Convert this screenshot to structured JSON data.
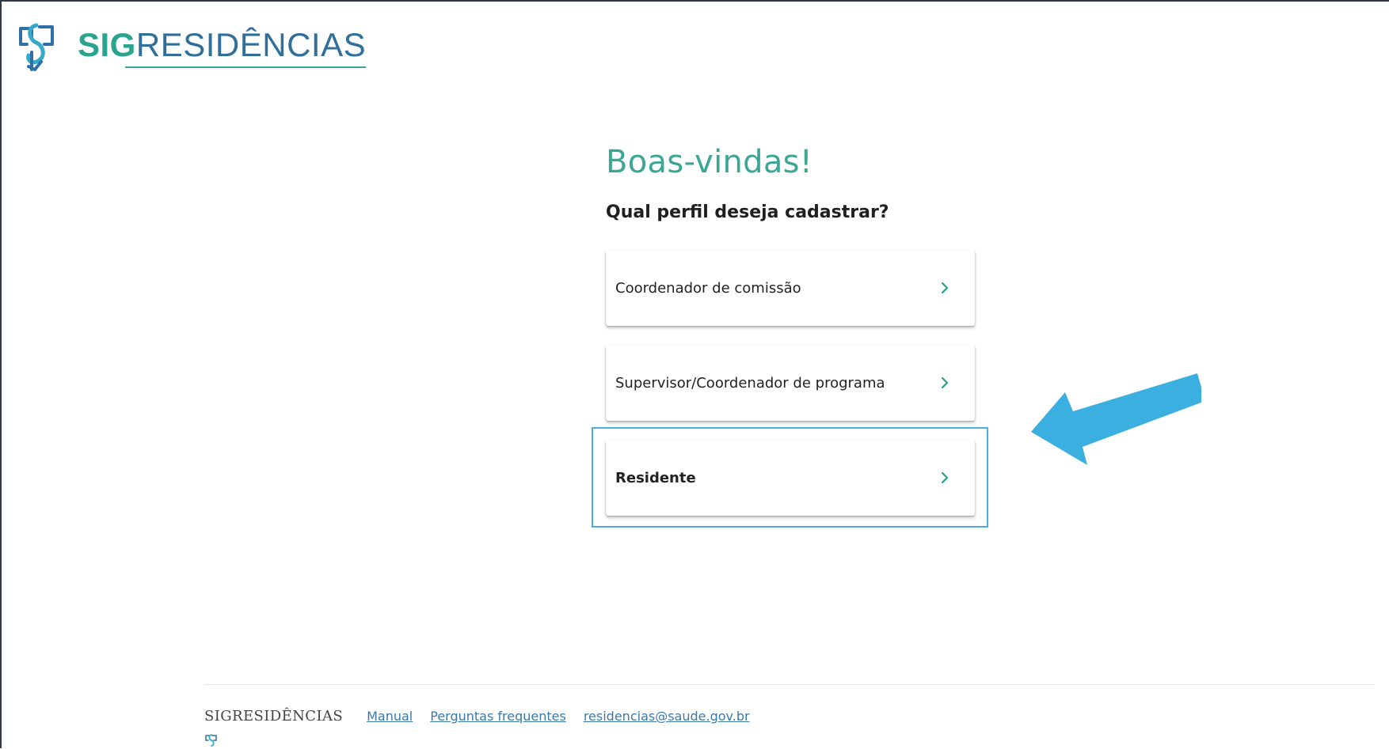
{
  "header": {
    "logo_icon": "sig-cross-logo-icon",
    "logo_sig": "SIG",
    "logo_rest": "RESIDÊNCIAS"
  },
  "main": {
    "title": "Boas-vindas!",
    "question": "Qual perfil deseja cadastrar?",
    "options": [
      {
        "label": "Coordenador de comissão",
        "icon": "chevron-right-icon"
      },
      {
        "label": "Supervisor/Coordenador de programa",
        "icon": "chevron-right-icon"
      },
      {
        "label": "Residente",
        "icon": "chevron-right-icon"
      }
    ]
  },
  "annotation": {
    "highlight_color": "#4aaee0",
    "arrow_color": "#3bb0e0",
    "arrow_icon": "pointing-arrow-icon"
  },
  "footer": {
    "brand": "SIGRESIDÊNCIAS",
    "links": [
      "Manual",
      "Perguntas frequentes",
      "residencias@saude.gov.br"
    ],
    "mark_icon": "sig-small-logo-icon"
  },
  "colors": {
    "accent": "#3aa693",
    "link": "#3a79a8",
    "brand_blue": "#2f6f9a"
  }
}
